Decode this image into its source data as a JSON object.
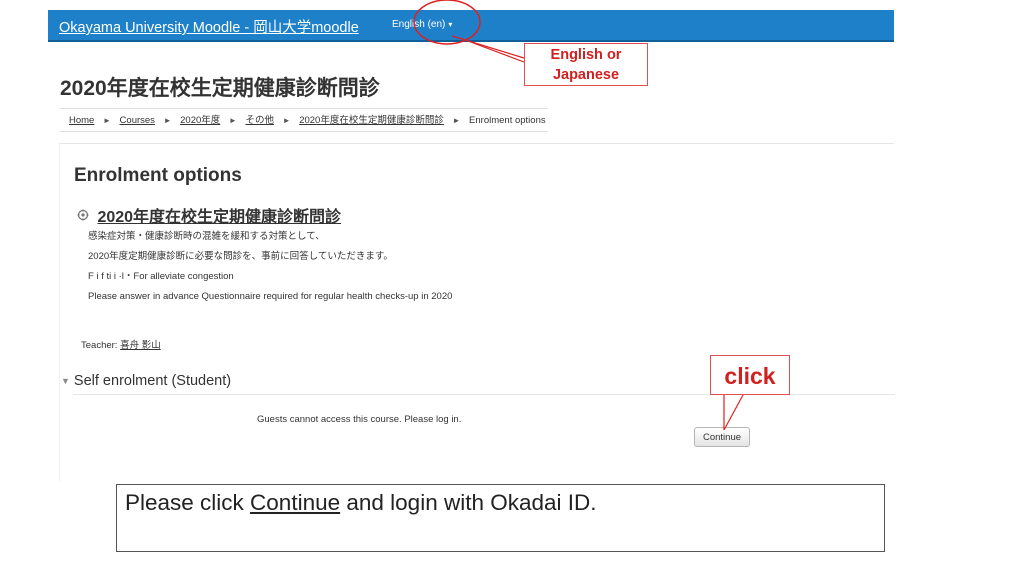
{
  "header": {
    "site_name": "Okayama University Moodle - 岡山大学moodle",
    "language": "English (en)",
    "language_caret": "▾"
  },
  "page": {
    "title": "2020年度在校生定期健康診断問診"
  },
  "breadcrumb": {
    "separator": "►",
    "items": [
      {
        "label": "Home"
      },
      {
        "label": "Courses"
      },
      {
        "label": "2020年度"
      },
      {
        "label": "その他"
      },
      {
        "label": "2020年度在校生定期健康診断問診"
      },
      {
        "label": "Enrolment options"
      }
    ]
  },
  "enrolment": {
    "heading": "Enrolment options",
    "course_name": "2020年度在校生定期健康診断問診",
    "summary": [
      "感染症対策・健康診断時の混雑を緩和する対策として、",
      "2020年度定期健康診断に必要な問診を、事前に回答していただきます。",
      "F     i  f  ti       i  ·l・For alleviate congestion",
      "Please answer in advance Questionnaire required for regular health checks-up in 2020"
    ],
    "teacher_label": "Teacher: ",
    "teacher_name": "喜舟 影山",
    "self_enrol_label": "Self enrolment (Student)",
    "guest_message": "Guests cannot access this course. Please log in.",
    "continue_label": "Continue"
  },
  "annotations": {
    "language_callout_line1": "English   or",
    "language_callout_line2": "Japanese",
    "click_callout": "click",
    "accent_color": "#e02020"
  },
  "instruction": {
    "before": "Please click ",
    "link": "Continue",
    "after": " and login with Okadai ID."
  },
  "icons": {
    "course_icon": "course-icon",
    "collapse_icon": "triangle-down-icon"
  }
}
